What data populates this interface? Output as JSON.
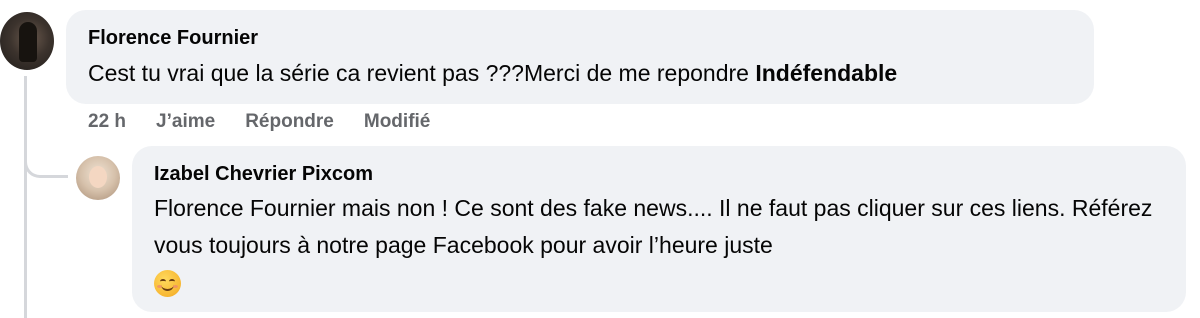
{
  "comment": {
    "author": "Florence Fournier",
    "text": "Cest tu vrai que la série ca revient pas ???Merci de me repondre",
    "tag": "Indéfendable",
    "meta": {
      "time": "22 h",
      "like": "J’aime",
      "reply": "Répondre",
      "edited": "Modifié"
    }
  },
  "reply": {
    "author": "Izabel Chevrier Pixcom",
    "text": "Florence Fournier mais non ! Ce sont des fake news.... Il ne faut pas cliquer sur ces liens. Référez vous toujours à notre page Facebook pour avoir l’heure juste",
    "emoji": "smiling-face-emoji"
  },
  "colors": {
    "bubble_bg": "#f0f2f5",
    "text_primary": "#050505",
    "text_secondary": "#65676b",
    "thread_line": "#d5d7db"
  }
}
